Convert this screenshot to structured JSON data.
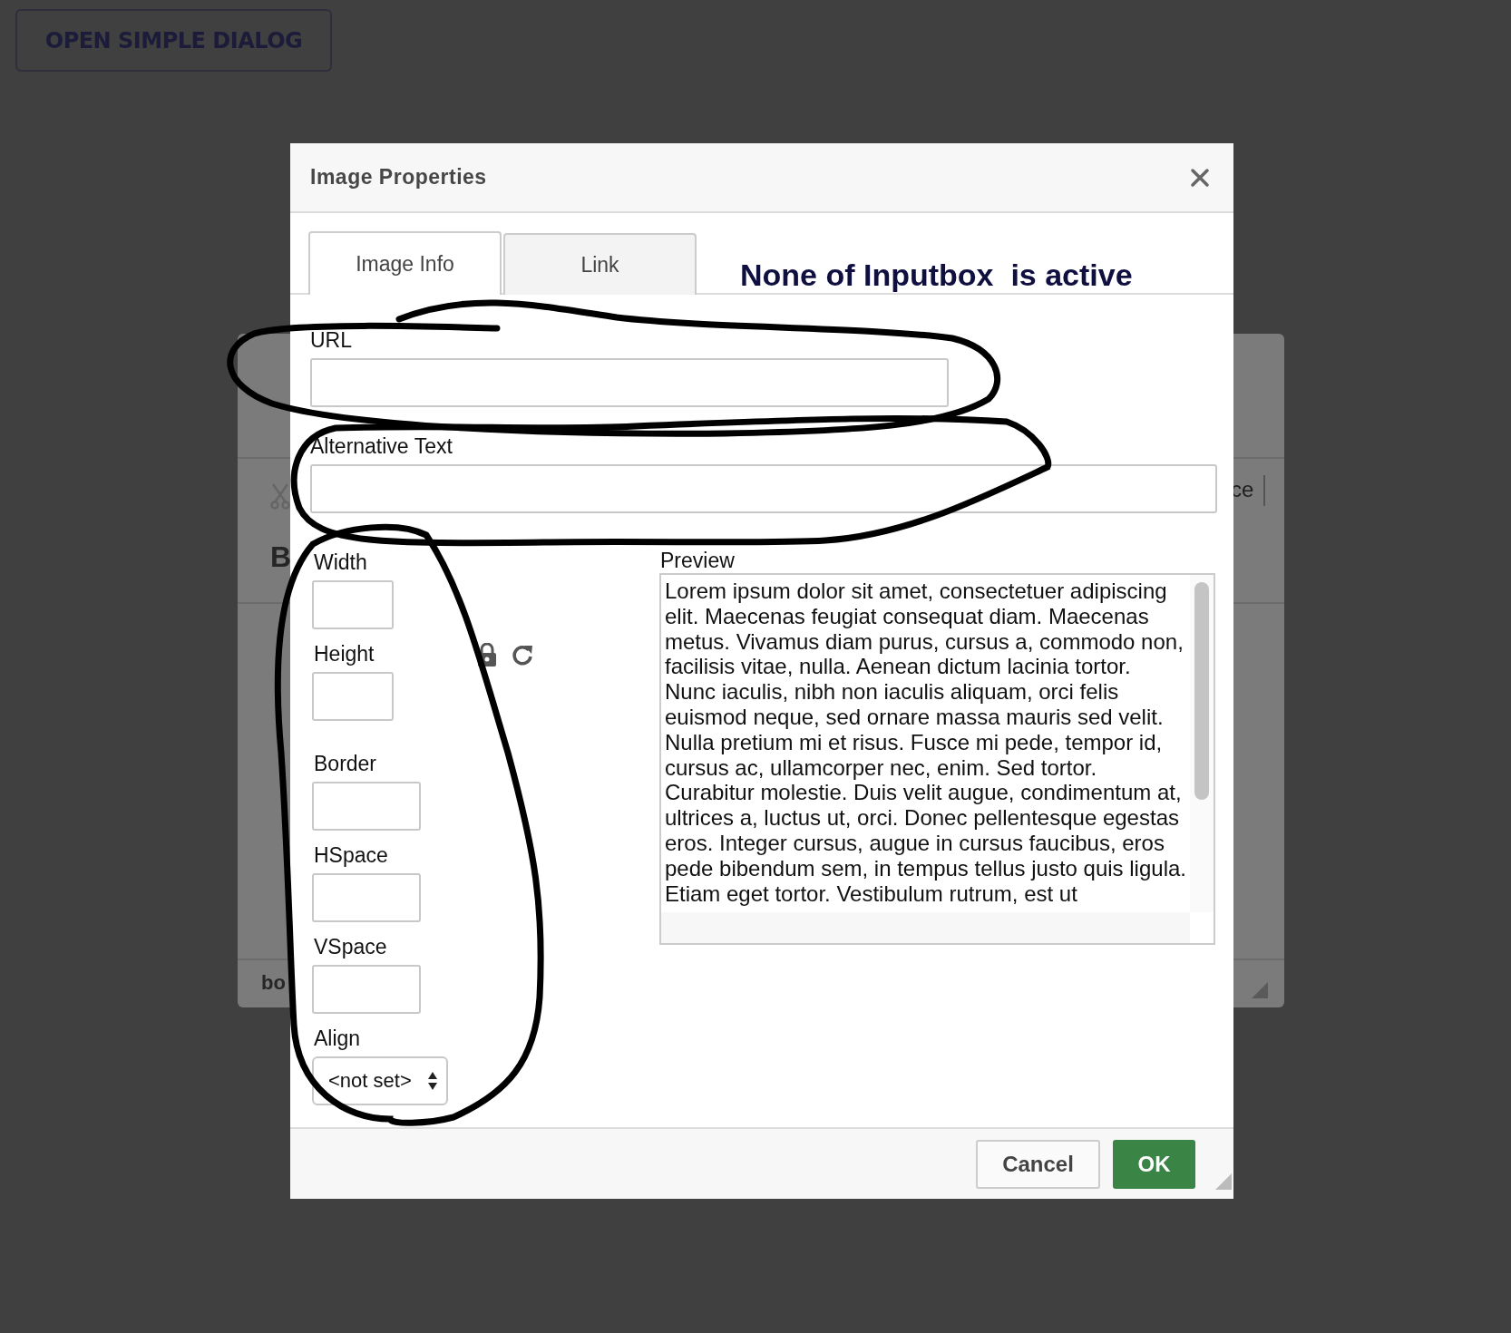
{
  "page_button": "OPEN SIMPLE DIALOG",
  "background_editor": {
    "toolbar_fragment": "ce",
    "format_fragment": "B",
    "status_fragment": "bo"
  },
  "dialog": {
    "title": "Image Properties",
    "tabs": [
      {
        "label": "Image Info",
        "selected": true
      },
      {
        "label": "Link",
        "selected": false
      }
    ],
    "notice": "None of Inputbox  is active",
    "url": {
      "label": "URL"
    },
    "alt_text": {
      "label": "Alternative Text"
    },
    "width": {
      "label": "Width"
    },
    "height": {
      "label": "Height"
    },
    "spacing_fields": [
      {
        "label": "Border"
      },
      {
        "label": "HSpace"
      },
      {
        "label": "VSpace"
      }
    ],
    "align": {
      "label": "Align",
      "value": "<not set>"
    },
    "preview": {
      "label": "Preview",
      "text": "Lorem ipsum dolor sit amet, consectetuer adipiscing elit. Maecenas feugiat consequat diam. Maecenas metus. Vivamus diam purus, cursus a, commodo non, facilisis vitae, nulla. Aenean dictum lacinia tortor. Nunc iaculis, nibh non iaculis aliquam, orci felis euismod neque, sed ornare massa mauris sed velit. Nulla pretium mi et risus. Fusce mi pede, tempor id, cursus ac, ullamcorper nec, enim. Sed tortor. Curabitur molestie. Duis velit augue, condimentum at, ultrices a, luctus ut, orci. Donec pellentesque egestas eros. Integer cursus, augue in cursus faucibus, eros pede bibendum sem, in tempus tellus justo quis ligula. Etiam eget tortor. Vestibulum rutrum, est ut"
    },
    "buttons": {
      "cancel": "Cancel",
      "ok": "OK"
    }
  }
}
